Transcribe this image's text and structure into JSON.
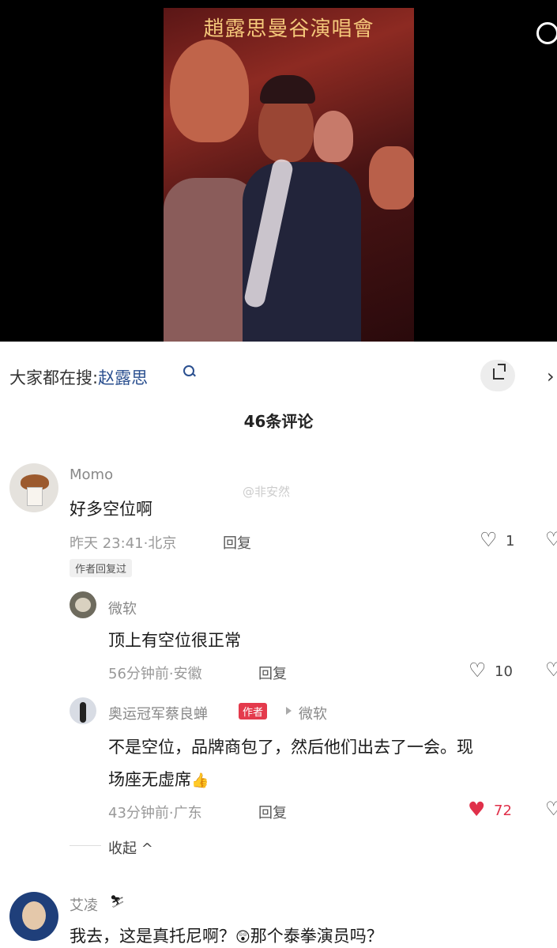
{
  "video": {
    "overlay_title": "趙露思曼谷演唱會"
  },
  "search": {
    "prefix": "大家都在搜:",
    "keyword": "赵露思"
  },
  "comments_header": {
    "count_label": "46条评论"
  },
  "watermark": "@非安然",
  "comments": [
    {
      "username": "Momo",
      "text": "好多空位啊",
      "time": "昨天 23:41",
      "location": "北京",
      "reply_label": "回复",
      "likes": "1",
      "badge": "作者回复过",
      "replies": [
        {
          "username": "微软",
          "text": "顶上有空位很正常",
          "time": "56分钟前",
          "location": "安徽",
          "reply_label": "回复",
          "likes": "10"
        },
        {
          "username": "奥运冠军蔡良蝉",
          "author_tag": "作者",
          "reply_to": "微软",
          "text_line1": "不是空位，品牌商包了，然后他们出去了一会。现",
          "text_line2": "场座无虚席",
          "time": "43分钟前",
          "location": "广东",
          "reply_label": "回复",
          "likes": "72"
        }
      ],
      "collapse_label": "收起"
    },
    {
      "username": "艾凌",
      "text_part1": "我去，这是真托尼啊？",
      "text_part2": "那个泰拳演员吗？"
    }
  ],
  "icons": {
    "heart": "heart-icon",
    "heart_liked": "heart-filled-icon",
    "thumbs_up": "thumbs-up-emoji",
    "search": "search-icon",
    "expand": "expand-icon"
  },
  "colors": {
    "accent": "#e0304a",
    "link": "#2a4f8f"
  }
}
